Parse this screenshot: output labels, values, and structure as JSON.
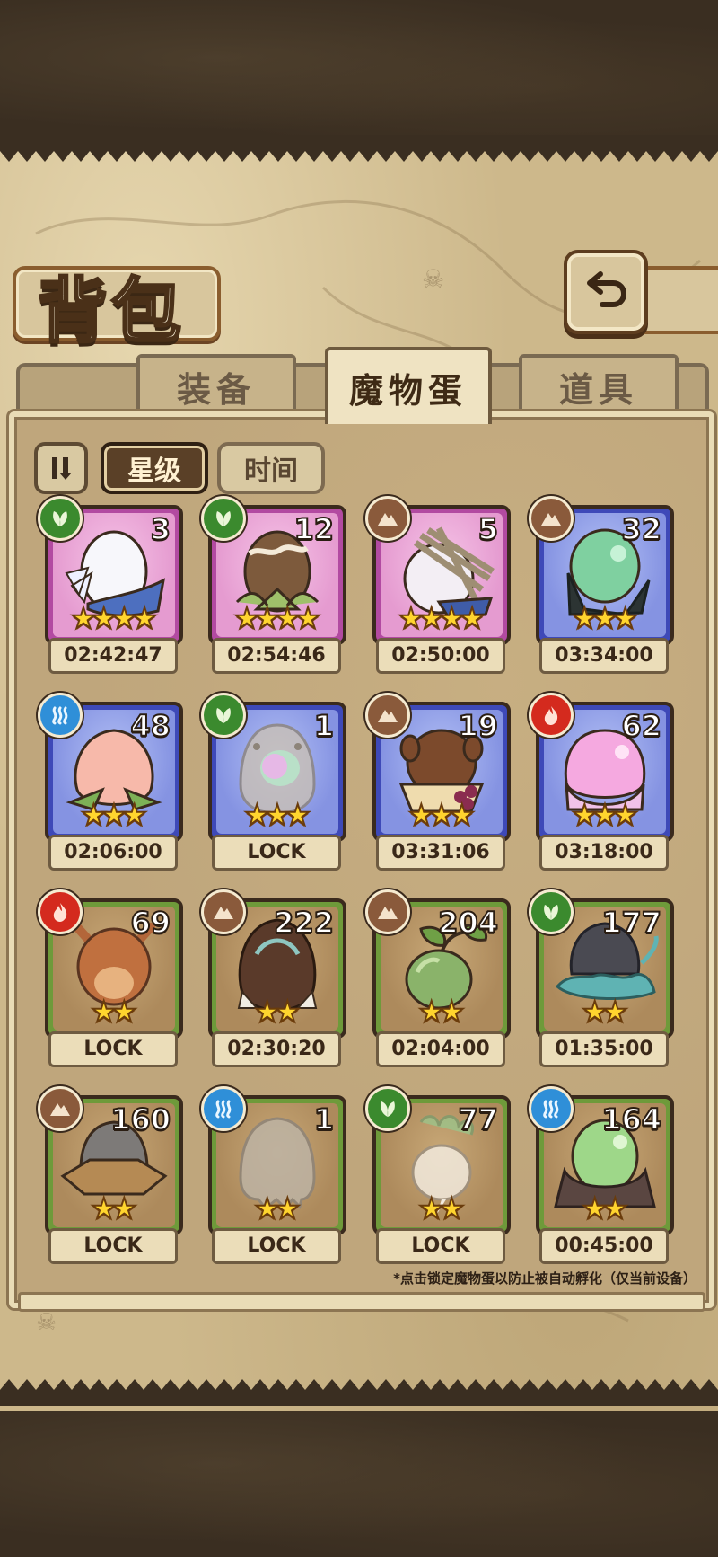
{
  "header": {
    "title": "背包"
  },
  "tabs": [
    {
      "label": "装备",
      "active": false
    },
    {
      "label": "魔物蛋",
      "active": true
    },
    {
      "label": "道具",
      "active": false
    }
  ],
  "sort": {
    "star_label": "星级",
    "time_label": "时间",
    "selected": "星级"
  },
  "eggs": [
    {
      "count": "3",
      "stars": 4,
      "rarity": "purple",
      "element": "leaf",
      "status": "02:42:47",
      "art": "white-feather"
    },
    {
      "count": "12",
      "stars": 4,
      "rarity": "purple",
      "element": "leaf",
      "status": "02:54:46",
      "art": "brown-leafy"
    },
    {
      "count": "5",
      "stars": 4,
      "rarity": "purple",
      "element": "rock",
      "status": "02:50:00",
      "art": "white-sticks"
    },
    {
      "count": "32",
      "stars": 3,
      "rarity": "blue",
      "element": "rock",
      "status": "03:34:00",
      "art": "green-dark"
    },
    {
      "count": "48",
      "stars": 3,
      "rarity": "blue",
      "element": "water",
      "status": "02:06:00",
      "art": "peach"
    },
    {
      "count": "1",
      "stars": 3,
      "rarity": "blue",
      "element": "leaf",
      "status": "LOCK",
      "art": "rainbow-gray"
    },
    {
      "count": "19",
      "stars": 3,
      "rarity": "blue",
      "element": "rock",
      "status": "03:31:06",
      "art": "squirrel"
    },
    {
      "count": "62",
      "stars": 3,
      "rarity": "blue",
      "element": "fire",
      "status": "03:18:00",
      "art": "pink-jelly"
    },
    {
      "count": "69",
      "stars": 2,
      "rarity": "green",
      "element": "fire",
      "status": "LOCK",
      "art": "orange-eared"
    },
    {
      "count": "222",
      "stars": 2,
      "rarity": "green",
      "element": "rock",
      "status": "02:30:20",
      "art": "dark-brown"
    },
    {
      "count": "204",
      "stars": 2,
      "rarity": "green",
      "element": "rock",
      "status": "02:04:00",
      "art": "green-sprout"
    },
    {
      "count": "177",
      "stars": 2,
      "rarity": "green",
      "element": "leaf",
      "status": "01:35:00",
      "art": "dark-rock-moss"
    },
    {
      "count": "160",
      "stars": 2,
      "rarity": "green",
      "element": "rock",
      "status": "LOCK",
      "art": "gray-hat"
    },
    {
      "count": "1",
      "stars": 2,
      "rarity": "green",
      "element": "water",
      "status": "LOCK",
      "art": "gray-drip"
    },
    {
      "count": "77",
      "stars": 2,
      "rarity": "green",
      "element": "leaf",
      "status": "LOCK",
      "art": "radish"
    },
    {
      "count": "164",
      "stars": 2,
      "rarity": "green",
      "element": "water",
      "status": "00:45:00",
      "art": "green-cloak"
    }
  ],
  "footnote": "*点击锁定魔物蛋以防止被自动孵化（仅当前设备）",
  "colors": {
    "rarity_purple": "#b24aa1",
    "rarity_blue": "#3e49b8",
    "rarity_green": "#6e9a3a",
    "element_leaf": "#3b8a2e",
    "element_rock": "#8a5a3b",
    "element_water": "#2f8fd8",
    "element_fire": "#d42a1e",
    "star": "#ffd52e"
  }
}
